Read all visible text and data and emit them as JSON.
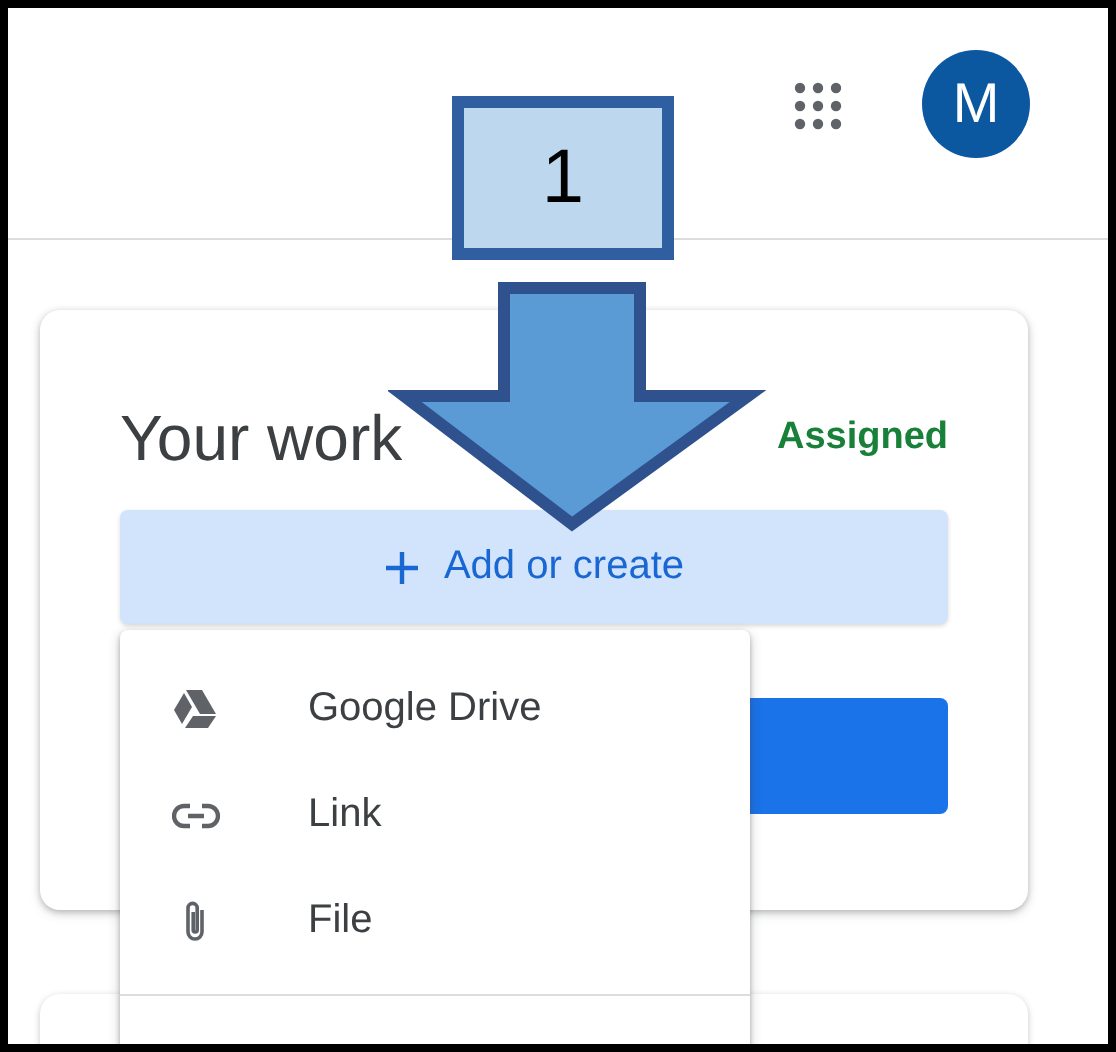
{
  "header": {
    "avatar": "M"
  },
  "callout": {
    "label": "1"
  },
  "work_card": {
    "title": "Your work",
    "status": "Assigned",
    "add_button": "Add or create"
  },
  "menu": {
    "items": [
      {
        "label": "Google Drive"
      },
      {
        "label": "Link"
      },
      {
        "label": "File"
      }
    ]
  }
}
